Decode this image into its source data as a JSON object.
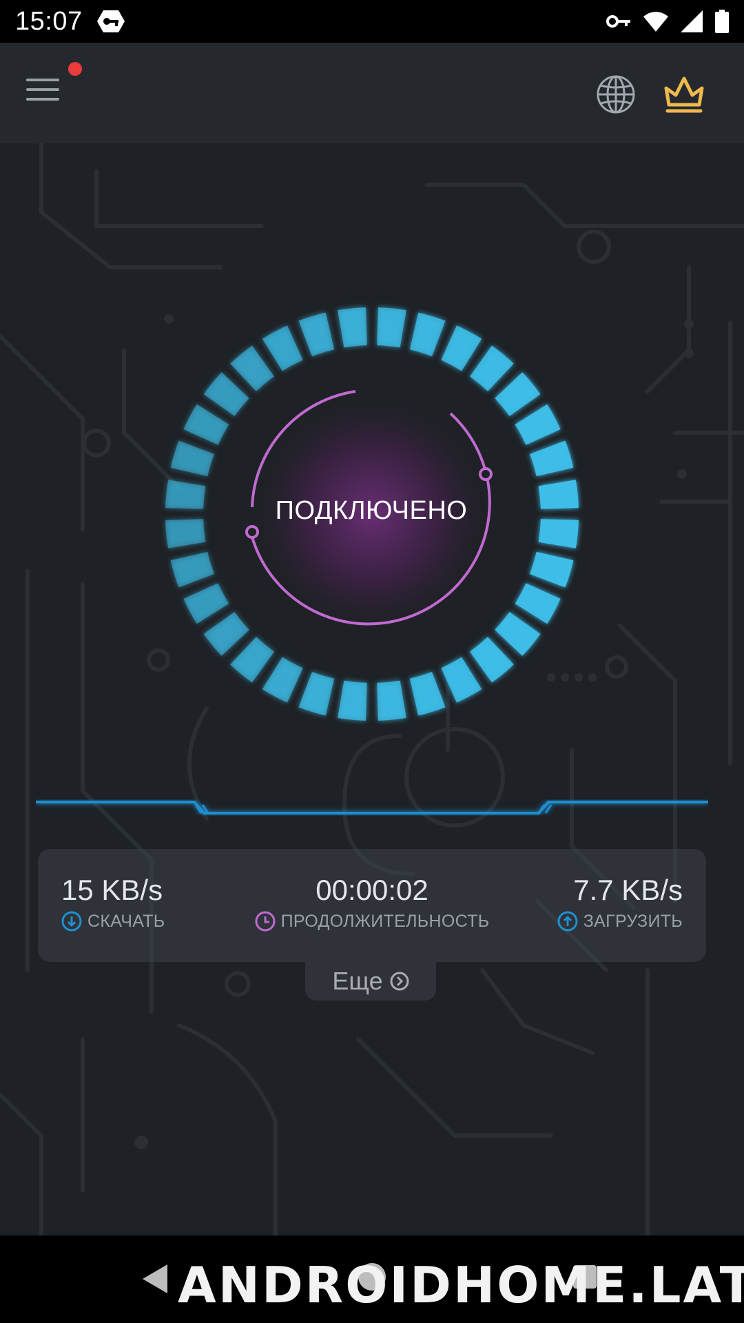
{
  "status_bar": {
    "time": "15:07",
    "icons": [
      "vpn-app-icon",
      "vpn-key-icon",
      "wifi-icon",
      "cellular-signal-icon",
      "battery-icon"
    ]
  },
  "app_bar": {
    "left_icon": "menu-icon",
    "notification_dot_color": "#ee3b3b",
    "right_icons": [
      "globe-icon",
      "crown-icon"
    ],
    "crown_color": "#f0b94e"
  },
  "connection": {
    "status_label": "ПОДКЛЮЧЕНО",
    "ring_color": "#3dbde8",
    "inner_arc_color": "#c06ad0"
  },
  "stats": {
    "download": {
      "value": "15 KB/s",
      "label": "СКАЧАТЬ",
      "icon": "download-arrow-icon"
    },
    "duration": {
      "value": "00:00:02",
      "label": "ПРОДОЛЖИТЕЛЬНОСТЬ",
      "icon": "clock-icon"
    },
    "upload": {
      "value": "7.7 KB/s",
      "label": "ЗАГРУЗИТЬ",
      "icon": "upload-arrow-icon"
    }
  },
  "more": {
    "label": "Еще",
    "icon": "chevron-circle-right-icon"
  },
  "nav_bar": {
    "icons": [
      "back-icon",
      "home-icon",
      "recents-icon"
    ],
    "watermark": "ANDROIDHOME.LAT"
  }
}
